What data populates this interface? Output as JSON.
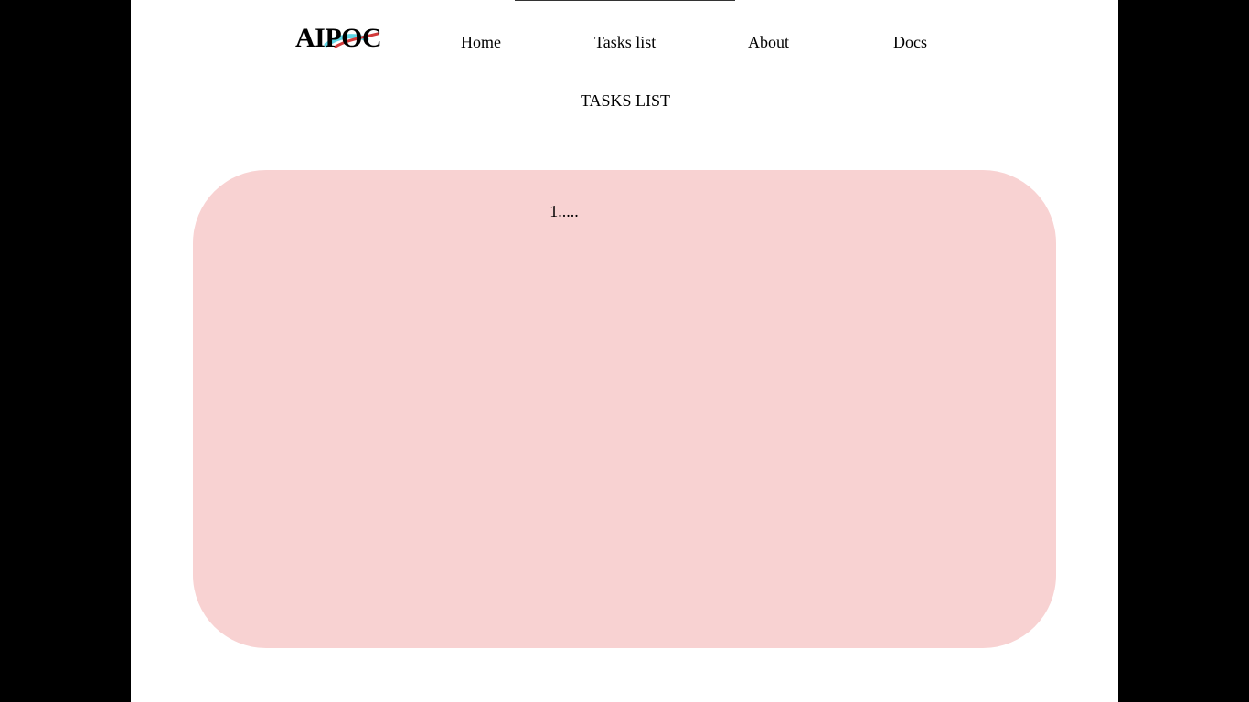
{
  "nav": {
    "logo_text": "AIPOC",
    "items": [
      {
        "label": "Home"
      },
      {
        "label": "Tasks list"
      },
      {
        "label": "About"
      },
      {
        "label": "Docs"
      }
    ]
  },
  "main": {
    "title": "TASKS LIST",
    "tasks": [
      {
        "text": "1....."
      }
    ]
  },
  "colors": {
    "outer_background": "#000000",
    "page_background": "#ffffff",
    "card_background": "#f8d2d2",
    "logo_accent_cyan": "#5fd6e6",
    "logo_accent_red": "#d23a3a"
  }
}
